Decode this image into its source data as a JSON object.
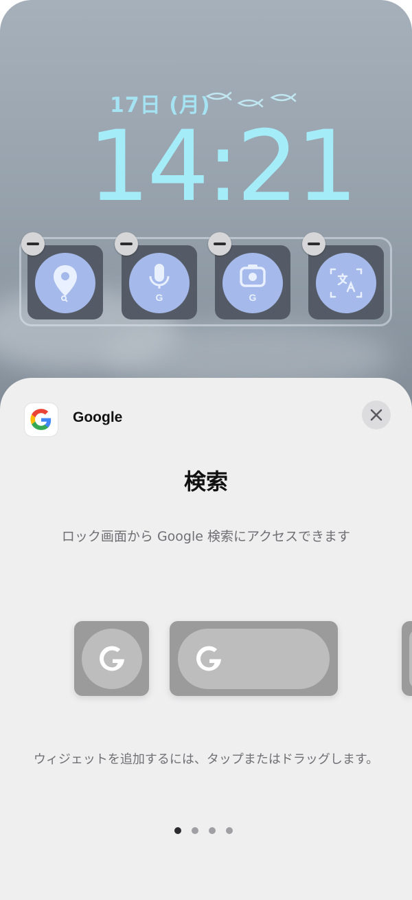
{
  "lock_screen": {
    "date": "17日 (月)",
    "time": "14:21",
    "colors": {
      "clock": "#a5ecf9",
      "widget_tile": "#545b66",
      "widget_circle": "#a5b9eb"
    },
    "widgets": [
      {
        "icon": "maps-pin-search-icon"
      },
      {
        "icon": "microphone-google-icon"
      },
      {
        "icon": "lens-camera-google-icon"
      },
      {
        "icon": "translate-icon"
      }
    ]
  },
  "sheet": {
    "app_name": "Google",
    "title": "検索",
    "description": "ロック画面から Google 検索にアクセスできます",
    "hint": "ウィジェットを追加するには、タップまたはドラッグします。",
    "close_icon": "close-icon",
    "page_count": 4,
    "active_page": 1
  }
}
